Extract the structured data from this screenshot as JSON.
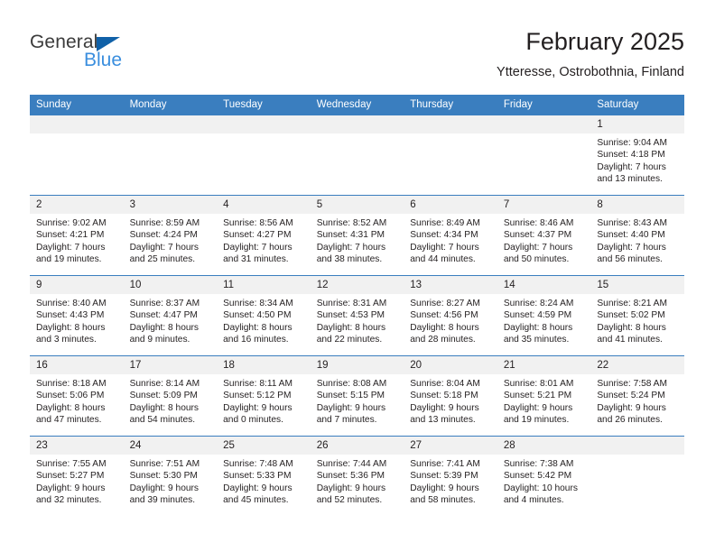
{
  "brand": {
    "name_part1": "General",
    "name_part2": "Blue"
  },
  "header": {
    "title": "February 2025",
    "location": "Ytteresse, Ostrobothnia, Finland"
  },
  "colors": {
    "header_blue": "#3a7ebf",
    "logo_blue": "#3a8ede",
    "logo_triangle": "#1061a8",
    "daynum_band": "#f1f1f1",
    "text": "#231f20"
  },
  "weekdays": [
    "Sunday",
    "Monday",
    "Tuesday",
    "Wednesday",
    "Thursday",
    "Friday",
    "Saturday"
  ],
  "weeks": [
    [
      {
        "day": "",
        "blank": true
      },
      {
        "day": "",
        "blank": true
      },
      {
        "day": "",
        "blank": true
      },
      {
        "day": "",
        "blank": true
      },
      {
        "day": "",
        "blank": true
      },
      {
        "day": "",
        "blank": true
      },
      {
        "day": "1",
        "sunrise": "Sunrise: 9:04 AM",
        "sunset": "Sunset: 4:18 PM",
        "daylight1": "Daylight: 7 hours",
        "daylight2": "and 13 minutes."
      }
    ],
    [
      {
        "day": "2",
        "sunrise": "Sunrise: 9:02 AM",
        "sunset": "Sunset: 4:21 PM",
        "daylight1": "Daylight: 7 hours",
        "daylight2": "and 19 minutes."
      },
      {
        "day": "3",
        "sunrise": "Sunrise: 8:59 AM",
        "sunset": "Sunset: 4:24 PM",
        "daylight1": "Daylight: 7 hours",
        "daylight2": "and 25 minutes."
      },
      {
        "day": "4",
        "sunrise": "Sunrise: 8:56 AM",
        "sunset": "Sunset: 4:27 PM",
        "daylight1": "Daylight: 7 hours",
        "daylight2": "and 31 minutes."
      },
      {
        "day": "5",
        "sunrise": "Sunrise: 8:52 AM",
        "sunset": "Sunset: 4:31 PM",
        "daylight1": "Daylight: 7 hours",
        "daylight2": "and 38 minutes."
      },
      {
        "day": "6",
        "sunrise": "Sunrise: 8:49 AM",
        "sunset": "Sunset: 4:34 PM",
        "daylight1": "Daylight: 7 hours",
        "daylight2": "and 44 minutes."
      },
      {
        "day": "7",
        "sunrise": "Sunrise: 8:46 AM",
        "sunset": "Sunset: 4:37 PM",
        "daylight1": "Daylight: 7 hours",
        "daylight2": "and 50 minutes."
      },
      {
        "day": "8",
        "sunrise": "Sunrise: 8:43 AM",
        "sunset": "Sunset: 4:40 PM",
        "daylight1": "Daylight: 7 hours",
        "daylight2": "and 56 minutes."
      }
    ],
    [
      {
        "day": "9",
        "sunrise": "Sunrise: 8:40 AM",
        "sunset": "Sunset: 4:43 PM",
        "daylight1": "Daylight: 8 hours",
        "daylight2": "and 3 minutes."
      },
      {
        "day": "10",
        "sunrise": "Sunrise: 8:37 AM",
        "sunset": "Sunset: 4:47 PM",
        "daylight1": "Daylight: 8 hours",
        "daylight2": "and 9 minutes."
      },
      {
        "day": "11",
        "sunrise": "Sunrise: 8:34 AM",
        "sunset": "Sunset: 4:50 PM",
        "daylight1": "Daylight: 8 hours",
        "daylight2": "and 16 minutes."
      },
      {
        "day": "12",
        "sunrise": "Sunrise: 8:31 AM",
        "sunset": "Sunset: 4:53 PM",
        "daylight1": "Daylight: 8 hours",
        "daylight2": "and 22 minutes."
      },
      {
        "day": "13",
        "sunrise": "Sunrise: 8:27 AM",
        "sunset": "Sunset: 4:56 PM",
        "daylight1": "Daylight: 8 hours",
        "daylight2": "and 28 minutes."
      },
      {
        "day": "14",
        "sunrise": "Sunrise: 8:24 AM",
        "sunset": "Sunset: 4:59 PM",
        "daylight1": "Daylight: 8 hours",
        "daylight2": "and 35 minutes."
      },
      {
        "day": "15",
        "sunrise": "Sunrise: 8:21 AM",
        "sunset": "Sunset: 5:02 PM",
        "daylight1": "Daylight: 8 hours",
        "daylight2": "and 41 minutes."
      }
    ],
    [
      {
        "day": "16",
        "sunrise": "Sunrise: 8:18 AM",
        "sunset": "Sunset: 5:06 PM",
        "daylight1": "Daylight: 8 hours",
        "daylight2": "and 47 minutes."
      },
      {
        "day": "17",
        "sunrise": "Sunrise: 8:14 AM",
        "sunset": "Sunset: 5:09 PM",
        "daylight1": "Daylight: 8 hours",
        "daylight2": "and 54 minutes."
      },
      {
        "day": "18",
        "sunrise": "Sunrise: 8:11 AM",
        "sunset": "Sunset: 5:12 PM",
        "daylight1": "Daylight: 9 hours",
        "daylight2": "and 0 minutes."
      },
      {
        "day": "19",
        "sunrise": "Sunrise: 8:08 AM",
        "sunset": "Sunset: 5:15 PM",
        "daylight1": "Daylight: 9 hours",
        "daylight2": "and 7 minutes."
      },
      {
        "day": "20",
        "sunrise": "Sunrise: 8:04 AM",
        "sunset": "Sunset: 5:18 PM",
        "daylight1": "Daylight: 9 hours",
        "daylight2": "and 13 minutes."
      },
      {
        "day": "21",
        "sunrise": "Sunrise: 8:01 AM",
        "sunset": "Sunset: 5:21 PM",
        "daylight1": "Daylight: 9 hours",
        "daylight2": "and 19 minutes."
      },
      {
        "day": "22",
        "sunrise": "Sunrise: 7:58 AM",
        "sunset": "Sunset: 5:24 PM",
        "daylight1": "Daylight: 9 hours",
        "daylight2": "and 26 minutes."
      }
    ],
    [
      {
        "day": "23",
        "sunrise": "Sunrise: 7:55 AM",
        "sunset": "Sunset: 5:27 PM",
        "daylight1": "Daylight: 9 hours",
        "daylight2": "and 32 minutes."
      },
      {
        "day": "24",
        "sunrise": "Sunrise: 7:51 AM",
        "sunset": "Sunset: 5:30 PM",
        "daylight1": "Daylight: 9 hours",
        "daylight2": "and 39 minutes."
      },
      {
        "day": "25",
        "sunrise": "Sunrise: 7:48 AM",
        "sunset": "Sunset: 5:33 PM",
        "daylight1": "Daylight: 9 hours",
        "daylight2": "and 45 minutes."
      },
      {
        "day": "26",
        "sunrise": "Sunrise: 7:44 AM",
        "sunset": "Sunset: 5:36 PM",
        "daylight1": "Daylight: 9 hours",
        "daylight2": "and 52 minutes."
      },
      {
        "day": "27",
        "sunrise": "Sunrise: 7:41 AM",
        "sunset": "Sunset: 5:39 PM",
        "daylight1": "Daylight: 9 hours",
        "daylight2": "and 58 minutes."
      },
      {
        "day": "28",
        "sunrise": "Sunrise: 7:38 AM",
        "sunset": "Sunset: 5:42 PM",
        "daylight1": "Daylight: 10 hours",
        "daylight2": "and 4 minutes."
      },
      {
        "day": "",
        "blank": true
      }
    ]
  ]
}
